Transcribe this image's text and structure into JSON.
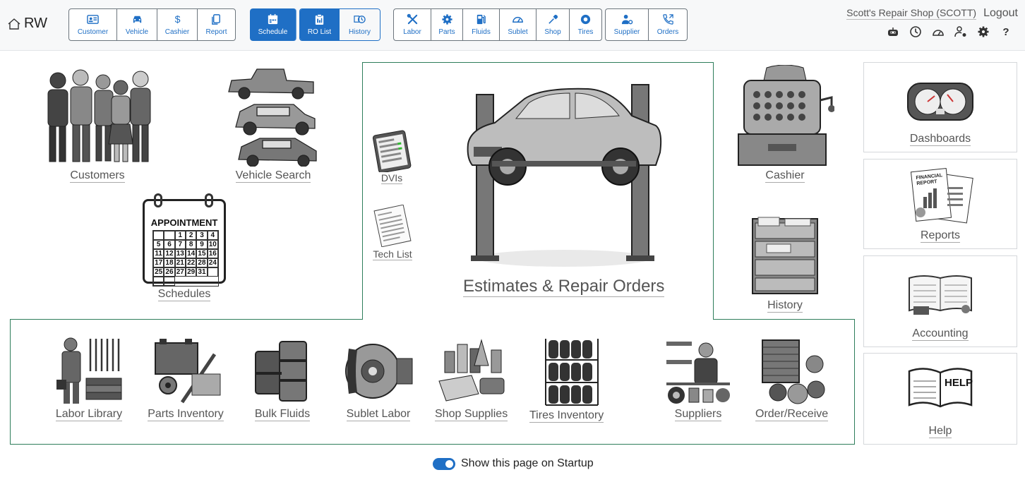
{
  "brand": {
    "text": "RW",
    "icon": "home-icon"
  },
  "toolbar": {
    "group1": [
      {
        "label": "Customer",
        "icon": "id-card-icon"
      },
      {
        "label": "Vehicle",
        "icon": "car-icon"
      },
      {
        "label": "Cashier",
        "icon": "dollar-icon"
      },
      {
        "label": "Report",
        "icon": "copy-icon"
      }
    ],
    "group2": [
      {
        "label": "Schedule",
        "icon": "calendar-icon"
      },
      {
        "label": "RO List",
        "icon": "clipboard-icon"
      },
      {
        "label": "History",
        "icon": "history-icon"
      }
    ],
    "group3": [
      {
        "label": "Labor",
        "icon": "wrench-screwdriver-icon"
      },
      {
        "label": "Parts",
        "icon": "gear-icon"
      },
      {
        "label": "Fluids",
        "icon": "fuel-pump-icon"
      },
      {
        "label": "Sublet",
        "icon": "speedometer-icon"
      },
      {
        "label": "Shop",
        "icon": "eyedropper-icon"
      },
      {
        "label": "Tires",
        "icon": "tire-icon"
      }
    ],
    "group4": [
      {
        "label": "Supplier",
        "icon": "person-gear-icon"
      },
      {
        "label": "Orders",
        "icon": "phone-outgoing-icon"
      }
    ]
  },
  "user": {
    "shop": "Scott's Repair Shop (SCOTT)",
    "logout": "Logout"
  },
  "util_icons": [
    "robot-icon",
    "clock-icon",
    "dashboard-icon",
    "user-gear-icon",
    "gear-icon",
    "help-icon"
  ],
  "help_glyph": "?",
  "tiles": {
    "customers": "Customers",
    "vehicle_search": "Vehicle Search",
    "schedules": "Schedules",
    "appointment_title": "APPOINTMENT",
    "calendar_days": [
      "",
      "",
      "1",
      "2",
      "3",
      "4",
      "5",
      "6",
      "7",
      "8",
      "9",
      "10",
      "11",
      "12",
      "13",
      "14",
      "15",
      "16",
      "17",
      "18",
      "21",
      "22",
      "28",
      "24",
      "25",
      "26",
      "27",
      "29",
      "31",
      "",
      "",
      ""
    ],
    "dvis": "DVIs",
    "tech_list": "Tech List",
    "estimates": "Estimates & Repair Orders",
    "cashier": "Cashier",
    "history": "History",
    "labor_library": "Labor Library",
    "parts_inventory": "Parts Inventory",
    "bulk_fluids": "Bulk Fluids",
    "sublet_labor": "Sublet Labor",
    "shop_supplies": "Shop Supplies",
    "tires_inventory": "Tires Inventory",
    "suppliers": "Suppliers",
    "order_receive": "Order/Receive"
  },
  "side": {
    "dashboards": "Dashboards",
    "reports": "Reports",
    "report_doc": "FINANCIAL REPORT",
    "accounting": "Accounting",
    "help": "Help",
    "help_book": "HELP"
  },
  "startup": {
    "label": "Show this page on Startup",
    "checked": true
  }
}
